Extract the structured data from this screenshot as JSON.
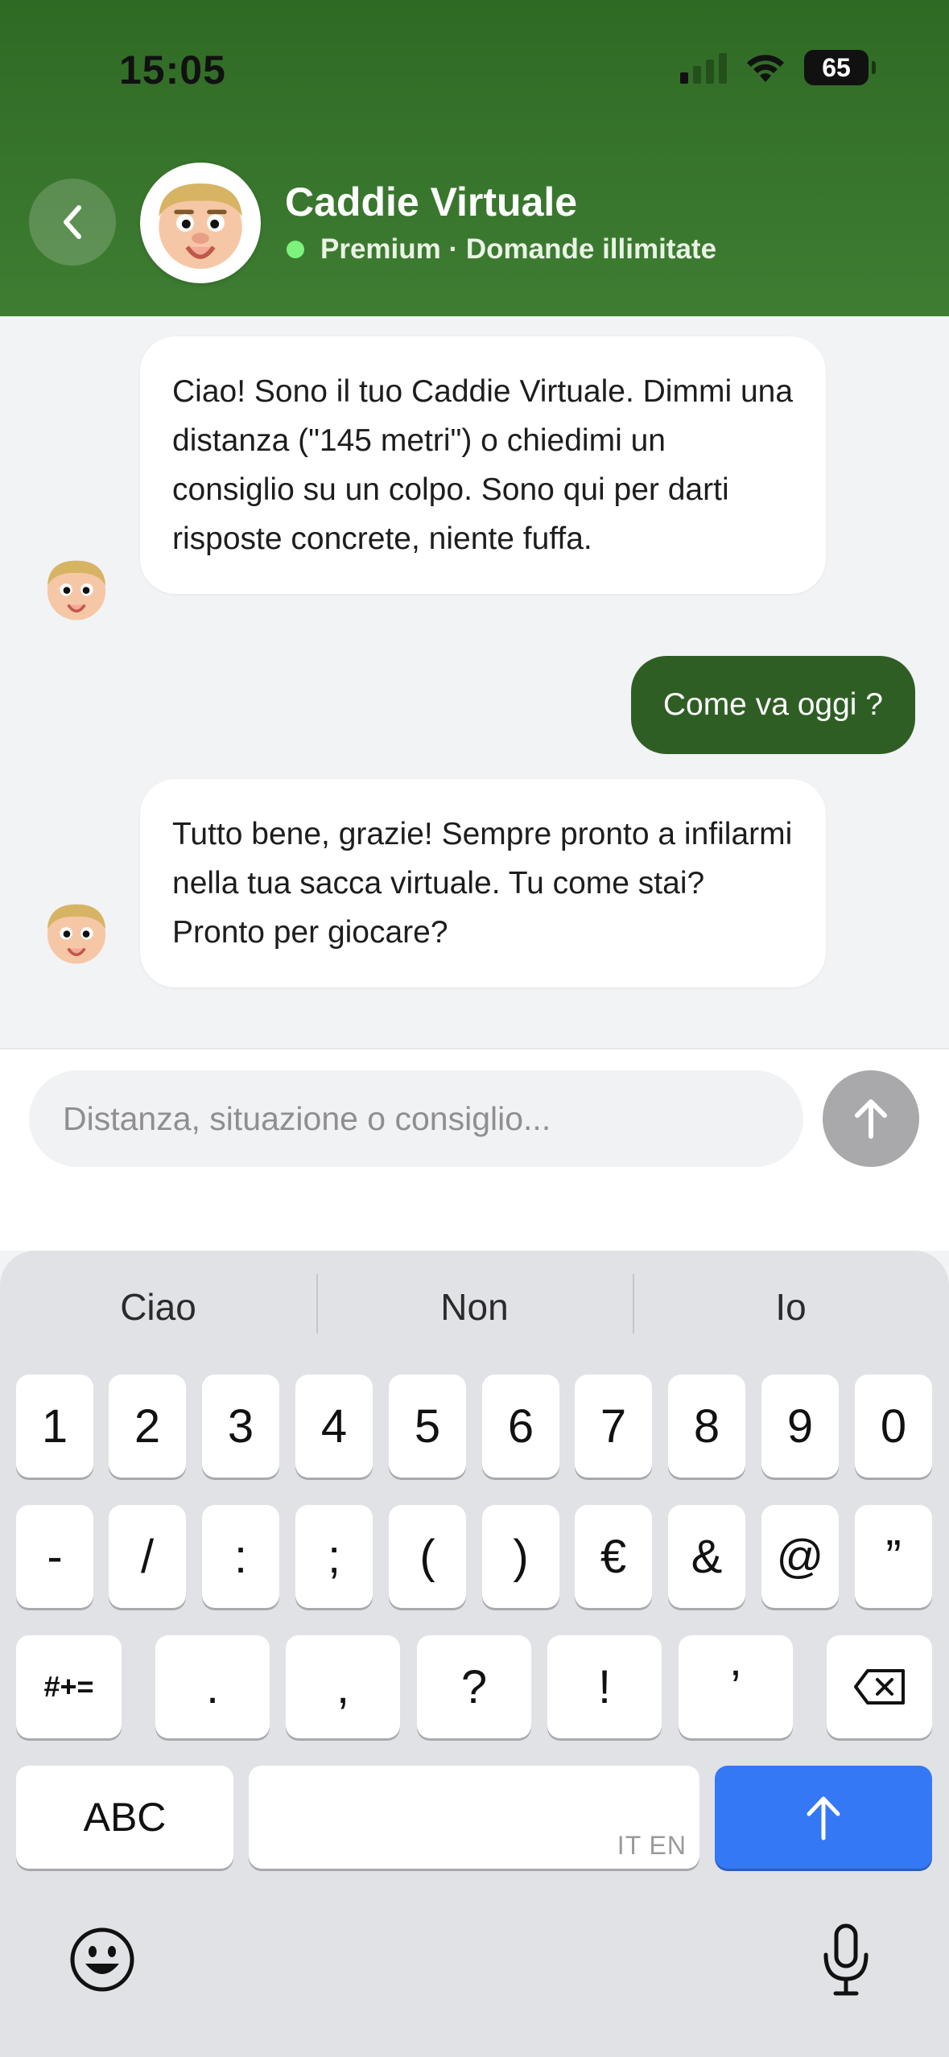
{
  "status": {
    "time": "15:05",
    "battery": "65"
  },
  "header": {
    "title": "Caddie Virtuale",
    "subtitle": "Premium · Domande illimitate",
    "online_color": "#7df27d"
  },
  "messages": [
    {
      "from": "bot",
      "text": "Ciao! Sono il tuo Caddie Virtuale. Dimmi una distanza (\"145 metri\") o chiedimi un consiglio su un colpo. Sono qui per darti risposte concrete, niente fuffa."
    },
    {
      "from": "user",
      "text": "Come va oggi ?"
    },
    {
      "from": "bot",
      "text": "Tutto bene, grazie! Sempre pronto a infilarmi nella tua sacca virtuale. Tu come stai? Pronto per giocare?"
    }
  ],
  "composer": {
    "placeholder": "Distanza, situazione o consiglio..."
  },
  "keyboard": {
    "suggestions": [
      "Ciao",
      "Non",
      "Io"
    ],
    "row1": [
      "1",
      "2",
      "3",
      "4",
      "5",
      "6",
      "7",
      "8",
      "9",
      "0"
    ],
    "row2": [
      "-",
      "/",
      ":",
      ";",
      "(",
      ")",
      "€",
      "&",
      "@",
      "”"
    ],
    "row3": [
      "#+=",
      ".",
      ",",
      "?",
      "!",
      "’"
    ],
    "abc_label": "ABC",
    "language": "IT EN"
  },
  "colors": {
    "header_green": "#2f6a24",
    "user_bubble": "#2f5e25",
    "send_disabled": "#a9a9ab",
    "keyboard_return": "#3478f6"
  }
}
